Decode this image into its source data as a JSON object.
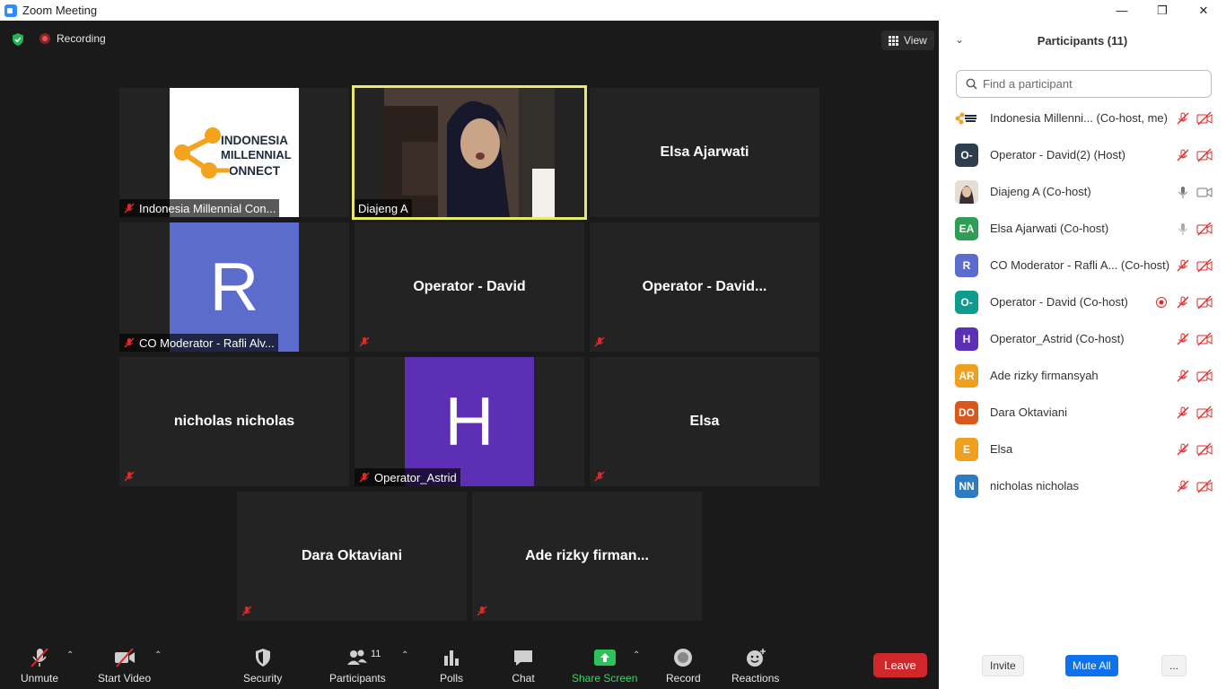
{
  "window": {
    "title": "Zoom Meeting"
  },
  "meeting": {
    "recording_label": "Recording",
    "view_label": "View"
  },
  "tiles": [
    {
      "name": "Indonesia Millennial Con...",
      "kind": "logo",
      "logo_lines": [
        "INDONESIA",
        "MILLENNIAL",
        "ONNECT"
      ]
    },
    {
      "name": "Diajeng A",
      "kind": "video",
      "active": true
    },
    {
      "name": "Elsa Ajarwati",
      "kind": "name"
    },
    {
      "name": "CO Moderator - Rafli Alv...",
      "kind": "avatar",
      "letter": "R",
      "color": "#5b6ccc"
    },
    {
      "name": "Operator - David",
      "kind": "name"
    },
    {
      "name": "Operator - David...",
      "kind": "name"
    },
    {
      "name": "nicholas nicholas",
      "kind": "name"
    },
    {
      "name": "Operator_Astrid",
      "kind": "avatar",
      "letter": "H",
      "color": "#5c2fb4"
    },
    {
      "name": "Elsa",
      "kind": "name"
    },
    {
      "name": "Dara Oktaviani",
      "kind": "name"
    },
    {
      "name": "Ade rizky firman...",
      "kind": "name"
    }
  ],
  "toolbar": {
    "unmute": "Unmute",
    "start_video": "Start Video",
    "security": "Security",
    "participants": "Participants",
    "participants_count": "11",
    "polls": "Polls",
    "chat": "Chat",
    "share_screen": "Share Screen",
    "record": "Record",
    "reactions": "Reactions",
    "leave": "Leave"
  },
  "panel": {
    "title": "Participants (11)",
    "search_placeholder": "Find a participant",
    "participants": [
      {
        "name": "Indonesia Millenni...  (Co-host, me)",
        "initials": "",
        "color": "#ffffff",
        "audio": "muted",
        "video": "off"
      },
      {
        "name": "Operator - David(2) (Host)",
        "initials": "O-",
        "color": "#2f3e4e",
        "audio": "muted",
        "video": "off"
      },
      {
        "name": "Diajeng A (Co-host)",
        "initials": "",
        "color": "#c9b7a8",
        "audio": "on",
        "video": "on"
      },
      {
        "name": "Elsa Ajarwati (Co-host)",
        "initials": "EA",
        "color": "#2e9d55",
        "audio": "on",
        "video": "off"
      },
      {
        "name": "CO Moderator - Rafli A... (Co-host)",
        "initials": "R",
        "color": "#5b6ccc",
        "audio": "muted",
        "video": "off"
      },
      {
        "name": "Operator - David (Co-host)",
        "initials": "O-",
        "color": "#0f9b8e",
        "audio": "muted",
        "video": "off",
        "recording": true
      },
      {
        "name": "Operator_Astrid (Co-host)",
        "initials": "H",
        "color": "#5c2fb4",
        "audio": "muted",
        "video": "off"
      },
      {
        "name": "Ade rizky firmansyah",
        "initials": "AR",
        "color": "#f0a020",
        "audio": "muted",
        "video": "off"
      },
      {
        "name": "Dara Oktaviani",
        "initials": "DO",
        "color": "#d9581d",
        "audio": "muted",
        "video": "off"
      },
      {
        "name": "Elsa",
        "initials": "E",
        "color": "#f0a020",
        "audio": "muted",
        "video": "off"
      },
      {
        "name": "nicholas nicholas",
        "initials": "NN",
        "color": "#2f7bbf",
        "audio": "muted",
        "video": "off"
      }
    ],
    "invite": "Invite",
    "mute_all": "Mute All",
    "more": "..."
  }
}
